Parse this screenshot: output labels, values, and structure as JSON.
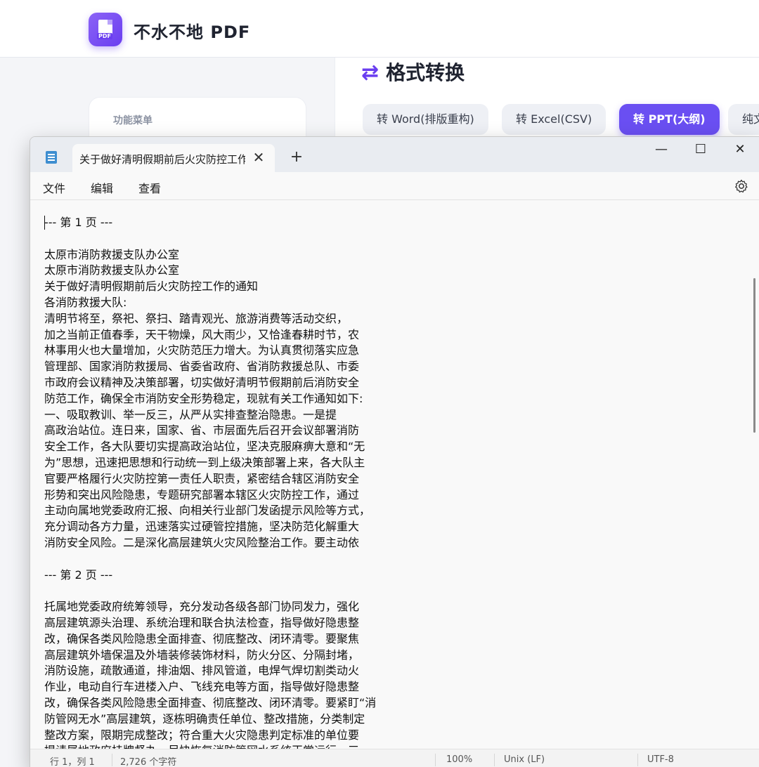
{
  "app": {
    "title": "不水不地 PDF",
    "logo_badge": "PDF",
    "brand_color": "#6a3ef0"
  },
  "sidebar": {
    "caption": "功能菜单"
  },
  "main": {
    "section_title": "格式转换",
    "section_icon": "swap-arrows-icon",
    "tabs": [
      {
        "label": "转 Word(排版重构)",
        "active": false
      },
      {
        "label": "转 Excel(CSV)",
        "active": false
      },
      {
        "label": "转 PPT(大纲)",
        "active": true
      },
      {
        "label": "纯文",
        "active": false
      }
    ]
  },
  "notepad": {
    "tab_title": "关于做好清明假期前后火灾防控工作",
    "tab_close": "✕",
    "new_tab": "+",
    "window_controls": {
      "minimize": "—",
      "maximize": "☐",
      "close": "✕"
    },
    "menu": [
      "文件",
      "编辑",
      "查看"
    ],
    "lines": [
      "--- 第 1 页 ---",
      "",
      "太原市消防救援支队办公室",
      "太原市消防救援支队办公室",
      "关于做好清明假期前后火灾防控工作的通知",
      "各消防救援大队:",
      "清明节将至，祭祀、祭扫、踏青观光、旅游消费等活动交织，",
      "加之当前正值春季，天干物燥，风大雨少，又恰逢春耕时节，农",
      "林事用火也大量增加，火灾防范压力增大。为认真贯彻落实应急",
      "管理部、国家消防救援局、省委省政府、省消防救援总队、市委",
      "市政府会议精神及决策部署，切实做好清明节假期前后消防安全",
      "防范工作，确保全市消防安全形势稳定，现就有关工作通知如下:",
      "一、吸取教训、举一反三，从严从实排查整治隐患。一是提",
      "高政治站位。连日来，国家、省、市层面先后召开会议部署消防",
      "安全工作，各大队要切实提高政治站位，坚决克服麻痹大意和“无",
      "为”思想，迅速把思想和行动统一到上级决策部署上来，各大队主",
      "官要严格履行火灾防控第一责任人职责，紧密结合辖区消防安全",
      "形势和突出风险隐患，专题研究部署本辖区火灾防控工作，通过",
      "主动向属地党委政府汇报、向相关行业部门发函提示风险等方式，",
      "充分调动各方力量，迅速落实过硬管控措施，坚决防范化解重大",
      "消防安全风险。二是深化高层建筑火灾风险整治工作。要主动依",
      "",
      "--- 第 2 页 ---",
      "",
      "托属地党委政府统筹领导，充分发动各级各部门协同发力，强化",
      "高层建筑源头治理、系统治理和联合执法检查，指导做好隐患整",
      "改，确保各类风险隐患全面排查、彻底整改、闭环清零。要聚焦",
      "高层建筑外墙保温及外墙装修装饰材料，防火分区、分隔封堵，",
      "消防设施，疏散通道，排油烟、排风管道，电焊气焊切割类动火",
      "作业，电动自行车进楼入户、飞线充电等方面，指导做好隐患整",
      "改，确保各类风险隐患全面排查、彻底整改、闭环清零。要紧盯“消",
      "防管网无水”高层建筑，逐栋明确责任单位、整改措施，分类制定",
      "整改方案，限期完成整改；符合重大火灾隐患判定标准的单位要",
      "提请属地政府挂牌督办，尽快恢复消防管网水系统正常运行。三"
    ],
    "status": {
      "position": "行 1，列 1",
      "chars": "2,726 个字符",
      "zoom": "100%",
      "eol": "Unix (LF)",
      "encoding": "UTF-8"
    }
  }
}
